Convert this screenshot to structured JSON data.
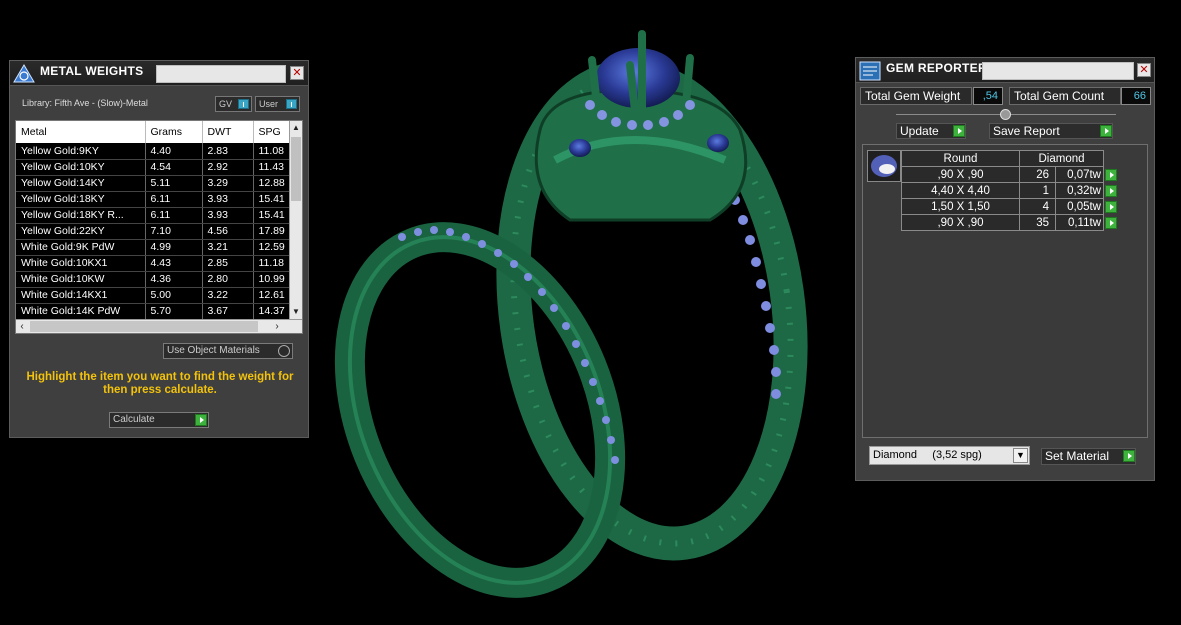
{
  "metal_weights": {
    "title": "METAL WEIGHTS",
    "library_label": "Library: Fifth Ave - (Slow)-Metal",
    "toggle_gv": "GV",
    "toggle_user": "User",
    "columns": [
      "Metal",
      "Grams",
      "DWT",
      "SPG"
    ],
    "rows": [
      [
        "Yellow Gold:9KY",
        "4.40",
        "2.83",
        "11.08"
      ],
      [
        "Yellow Gold:10KY",
        "4.54",
        "2.92",
        "11.43"
      ],
      [
        "Yellow Gold:14KY",
        "5.11",
        "3.29",
        "12.88"
      ],
      [
        "Yellow Gold:18KY",
        "6.11",
        "3.93",
        "15.41"
      ],
      [
        "Yellow Gold:18KY R...",
        "6.11",
        "3.93",
        "15.41"
      ],
      [
        "Yellow Gold:22KY",
        "7.10",
        "4.56",
        "17.89"
      ],
      [
        "White Gold:9K PdW",
        "4.99",
        "3.21",
        "12.59"
      ],
      [
        "White Gold:10KX1",
        "4.43",
        "2.85",
        "11.18"
      ],
      [
        "White Gold:10KW",
        "4.36",
        "2.80",
        "10.99"
      ],
      [
        "White Gold:14KX1",
        "5.00",
        "3.22",
        "12.61"
      ],
      [
        "White Gold:14K PdW",
        "5.70",
        "3.67",
        "14.37"
      ]
    ],
    "use_object_materials": "Use Object Materials",
    "hint": "Highlight the item you want to find the weight for then press calculate.",
    "calculate_label": "Calculate"
  },
  "gem_reporter": {
    "title": "GEM REPORTER",
    "total_weight_label": "Total Gem Weight",
    "total_weight_value": ",54",
    "total_count_label": "Total Gem Count",
    "total_count_value": "66",
    "update_label": "Update",
    "save_report_label": "Save Report",
    "columns": [
      "Round",
      "Diamond"
    ],
    "rows": [
      [
        ",90 X ,90",
        "26",
        "0,07tw"
      ],
      [
        "4,40 X 4,40",
        "1",
        "0,32tw"
      ],
      [
        "1,50 X 1,50",
        "4",
        "0,05tw"
      ],
      [
        ",90 X ,90",
        "35",
        "0,11tw"
      ]
    ],
    "material_select": "Diamond     (3,52 spg)",
    "set_material_label": "Set Material"
  },
  "colors": {
    "ring_green": "#1f6e48",
    "gem_blue": "#2e3f9a",
    "accent_green": "#3db33d",
    "value_cyan": "#4fc6e6",
    "hint_yellow": "#f2c20c"
  }
}
